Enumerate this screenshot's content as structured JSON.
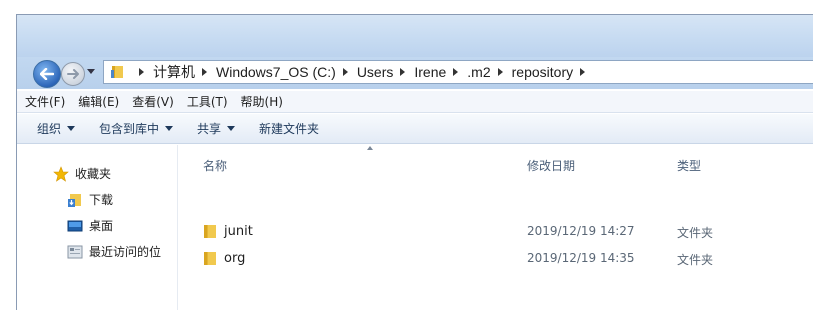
{
  "address": {
    "crumbs": [
      "计算机",
      "Windows7_OS (C:)",
      "Users",
      "Irene",
      ".m2",
      "repository"
    ]
  },
  "menu": [
    "文件(F)",
    "编辑(E)",
    "查看(V)",
    "工具(T)",
    "帮助(H)"
  ],
  "toolbar": {
    "organize": "组织",
    "include_library": "包含到库中",
    "share": "共享",
    "new_folder": "新建文件夹"
  },
  "nav": {
    "favorites": "收藏夹",
    "downloads": "下载",
    "desktop": "桌面",
    "recent": "最近访问的位"
  },
  "columns": {
    "name": "名称",
    "date": "修改日期",
    "type": "类型"
  },
  "files": [
    {
      "name": "junit",
      "date": "2019/12/19 14:27",
      "type": "文件夹"
    },
    {
      "name": "org",
      "date": "2019/12/19 14:35",
      "type": "文件夹"
    }
  ],
  "colors": {
    "folder": "#e8b83a",
    "star": "#f2b705",
    "accent": "#2d66b9"
  }
}
